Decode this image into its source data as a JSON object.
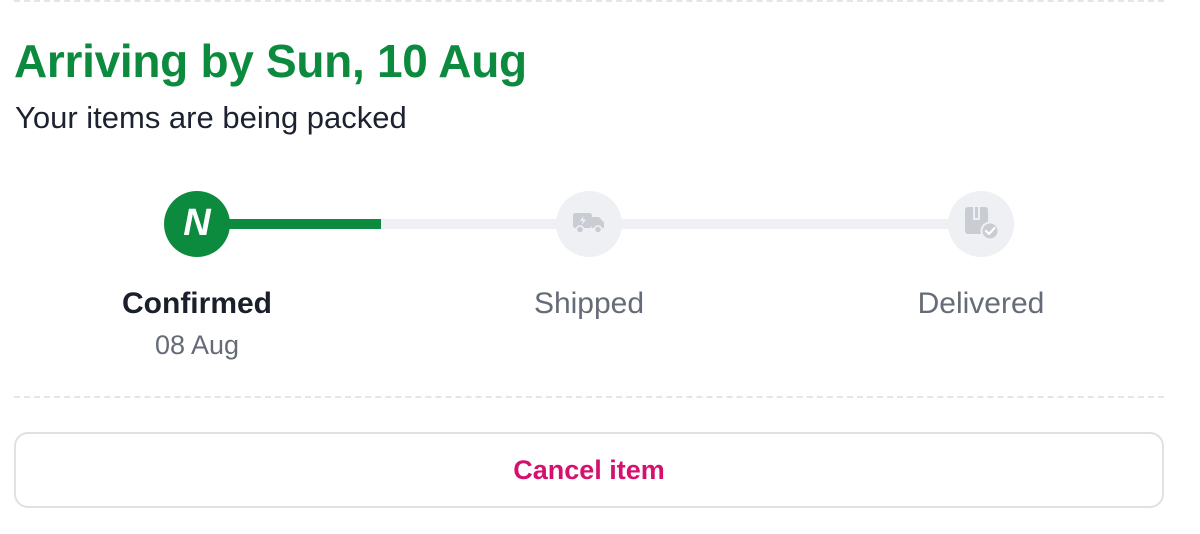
{
  "delivery": {
    "headline": "Arriving by Sun, 10 Aug",
    "status_text": "Your items are being packed"
  },
  "tracker": {
    "progress_fraction": 0.235,
    "active_color": "#0c8a3e",
    "inactive_color": "#eff0f4",
    "steps": [
      {
        "label": "Confirmed",
        "date": "08 Aug",
        "state": "done",
        "icon": "brand-n-icon",
        "icon_glyph": "N"
      },
      {
        "label": "Shipped",
        "state": "pending",
        "icon": "truck-icon"
      },
      {
        "label": "Delivered",
        "state": "pending",
        "icon": "package-check-icon"
      }
    ]
  },
  "actions": {
    "cancel_label": "Cancel item",
    "cancel_color": "#d6106e"
  }
}
